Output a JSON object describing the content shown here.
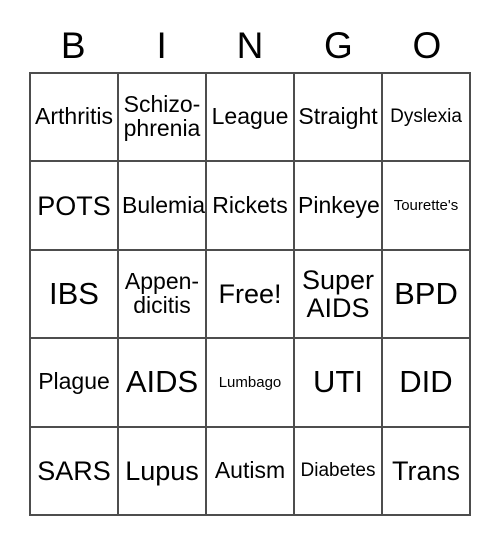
{
  "card": {
    "title": "BINGO",
    "header": {
      "letters": [
        "B",
        "I",
        "N",
        "G",
        "O"
      ]
    },
    "colors": {
      "grid_line": "#4d4d4d",
      "text": "#000000",
      "background": "#ffffff"
    },
    "rows": [
      [
        {
          "label": "Arthritis",
          "size": "fs-md"
        },
        {
          "label": "Schizo-\nphrenia",
          "size": "fs-md"
        },
        {
          "label": "League",
          "size": "fs-md"
        },
        {
          "label": "Straight",
          "size": "fs-md"
        },
        {
          "label": "Dyslexia",
          "size": "fs-sm"
        }
      ],
      [
        {
          "label": "POTS",
          "size": "fs-lg"
        },
        {
          "label": "Bulemia",
          "size": "fs-md"
        },
        {
          "label": "Rickets",
          "size": "fs-md"
        },
        {
          "label": "Pinkeye",
          "size": "fs-md"
        },
        {
          "label": "Tourette's",
          "size": "fs-xs"
        }
      ],
      [
        {
          "label": "IBS",
          "size": "fs-xl"
        },
        {
          "label": "Appen-\ndicitis",
          "size": "fs-md"
        },
        {
          "label": "Free!",
          "size": "fs-lg"
        },
        {
          "label": "Super\nAIDS",
          "size": "fs-lg"
        },
        {
          "label": "BPD",
          "size": "fs-xl"
        }
      ],
      [
        {
          "label": "Plague",
          "size": "fs-md"
        },
        {
          "label": "AIDS",
          "size": "fs-xl"
        },
        {
          "label": "Lumbago",
          "size": "fs-xs"
        },
        {
          "label": "UTI",
          "size": "fs-xl"
        },
        {
          "label": "DID",
          "size": "fs-xl"
        }
      ],
      [
        {
          "label": "SARS",
          "size": "fs-lg"
        },
        {
          "label": "Lupus",
          "size": "fs-lg"
        },
        {
          "label": "Autism",
          "size": "fs-md"
        },
        {
          "label": "Diabetes",
          "size": "fs-sm"
        },
        {
          "label": "Trans",
          "size": "fs-lg"
        }
      ]
    ]
  }
}
